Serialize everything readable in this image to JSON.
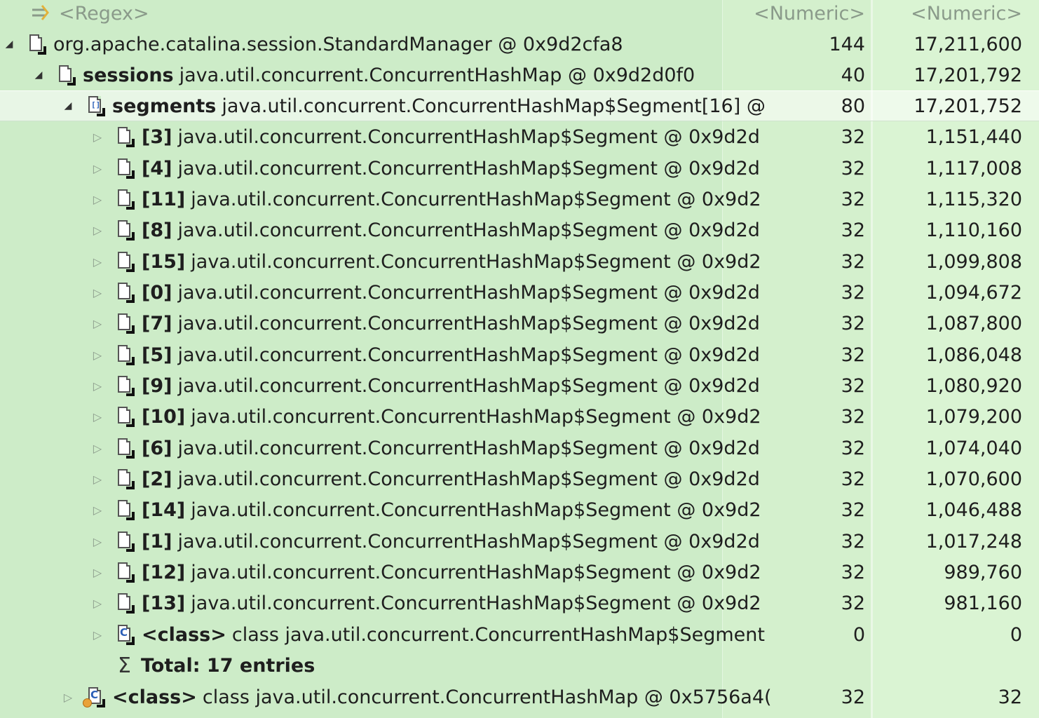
{
  "header": {
    "name_filter": "<Regex>",
    "shallow_filter": "<Numeric>",
    "retained_filter": "<Numeric>"
  },
  "rows": [
    {
      "bold": "",
      "text": "org.apache.catalina.session.StandardManager @ 0x9d2cfa8",
      "shallow": "144",
      "retained": "17,211,600"
    },
    {
      "bold": "sessions",
      "text": "java.util.concurrent.ConcurrentHashMap @ 0x9d2d0f0",
      "shallow": "40",
      "retained": "17,201,792"
    },
    {
      "bold": "segments",
      "text": "java.util.concurrent.ConcurrentHashMap$Segment[16] @",
      "shallow": "80",
      "retained": "17,201,752"
    },
    {
      "bold": "[3]",
      "text": "java.util.concurrent.ConcurrentHashMap$Segment @ 0x9d2d",
      "shallow": "32",
      "retained": "1,151,440"
    },
    {
      "bold": "[4]",
      "text": "java.util.concurrent.ConcurrentHashMap$Segment @ 0x9d2d",
      "shallow": "32",
      "retained": "1,117,008"
    },
    {
      "bold": "[11]",
      "text": "java.util.concurrent.ConcurrentHashMap$Segment @ 0x9d2",
      "shallow": "32",
      "retained": "1,115,320"
    },
    {
      "bold": "[8]",
      "text": "java.util.concurrent.ConcurrentHashMap$Segment @ 0x9d2d",
      "shallow": "32",
      "retained": "1,110,160"
    },
    {
      "bold": "[15]",
      "text": "java.util.concurrent.ConcurrentHashMap$Segment @ 0x9d2",
      "shallow": "32",
      "retained": "1,099,808"
    },
    {
      "bold": "[0]",
      "text": "java.util.concurrent.ConcurrentHashMap$Segment @ 0x9d2d",
      "shallow": "32",
      "retained": "1,094,672"
    },
    {
      "bold": "[7]",
      "text": "java.util.concurrent.ConcurrentHashMap$Segment @ 0x9d2d",
      "shallow": "32",
      "retained": "1,087,800"
    },
    {
      "bold": "[5]",
      "text": "java.util.concurrent.ConcurrentHashMap$Segment @ 0x9d2d",
      "shallow": "32",
      "retained": "1,086,048"
    },
    {
      "bold": "[9]",
      "text": "java.util.concurrent.ConcurrentHashMap$Segment @ 0x9d2d",
      "shallow": "32",
      "retained": "1,080,920"
    },
    {
      "bold": "[10]",
      "text": "java.util.concurrent.ConcurrentHashMap$Segment @ 0x9d2",
      "shallow": "32",
      "retained": "1,079,200"
    },
    {
      "bold": "[6]",
      "text": "java.util.concurrent.ConcurrentHashMap$Segment @ 0x9d2d",
      "shallow": "32",
      "retained": "1,074,040"
    },
    {
      "bold": "[2]",
      "text": "java.util.concurrent.ConcurrentHashMap$Segment @ 0x9d2d",
      "shallow": "32",
      "retained": "1,070,600"
    },
    {
      "bold": "[14]",
      "text": "java.util.concurrent.ConcurrentHashMap$Segment @ 0x9d2",
      "shallow": "32",
      "retained": "1,046,488"
    },
    {
      "bold": "[1]",
      "text": "java.util.concurrent.ConcurrentHashMap$Segment @ 0x9d2d",
      "shallow": "32",
      "retained": "1,017,248"
    },
    {
      "bold": "[12]",
      "text": "java.util.concurrent.ConcurrentHashMap$Segment @ 0x9d2",
      "shallow": "32",
      "retained": "989,760"
    },
    {
      "bold": "[13]",
      "text": "java.util.concurrent.ConcurrentHashMap$Segment @ 0x9d2",
      "shallow": "32",
      "retained": "981,160"
    },
    {
      "bold": "<class>",
      "text": "class java.util.concurrent.ConcurrentHashMap$Segment",
      "shallow": "0",
      "retained": "0"
    },
    {
      "bold": "",
      "text": "Total: 17 entries",
      "shallow": "",
      "retained": ""
    },
    {
      "bold": "<class>",
      "text": "class java.util.concurrent.ConcurrentHashMap @ 0x5756a4(",
      "shallow": "32",
      "retained": "32"
    }
  ],
  "icons": {
    "filter": "regex-filter-icon",
    "object": "object-doc-icon",
    "array": "array-doc-icon",
    "class": "class-doc-icon",
    "sum": "sigma-icon"
  },
  "colors": {
    "background": "#d6f1d6",
    "selected_row": "#eaf3e6",
    "muted_text": "#8a9a8a",
    "class_icon_accent": "#2b5fb8"
  }
}
